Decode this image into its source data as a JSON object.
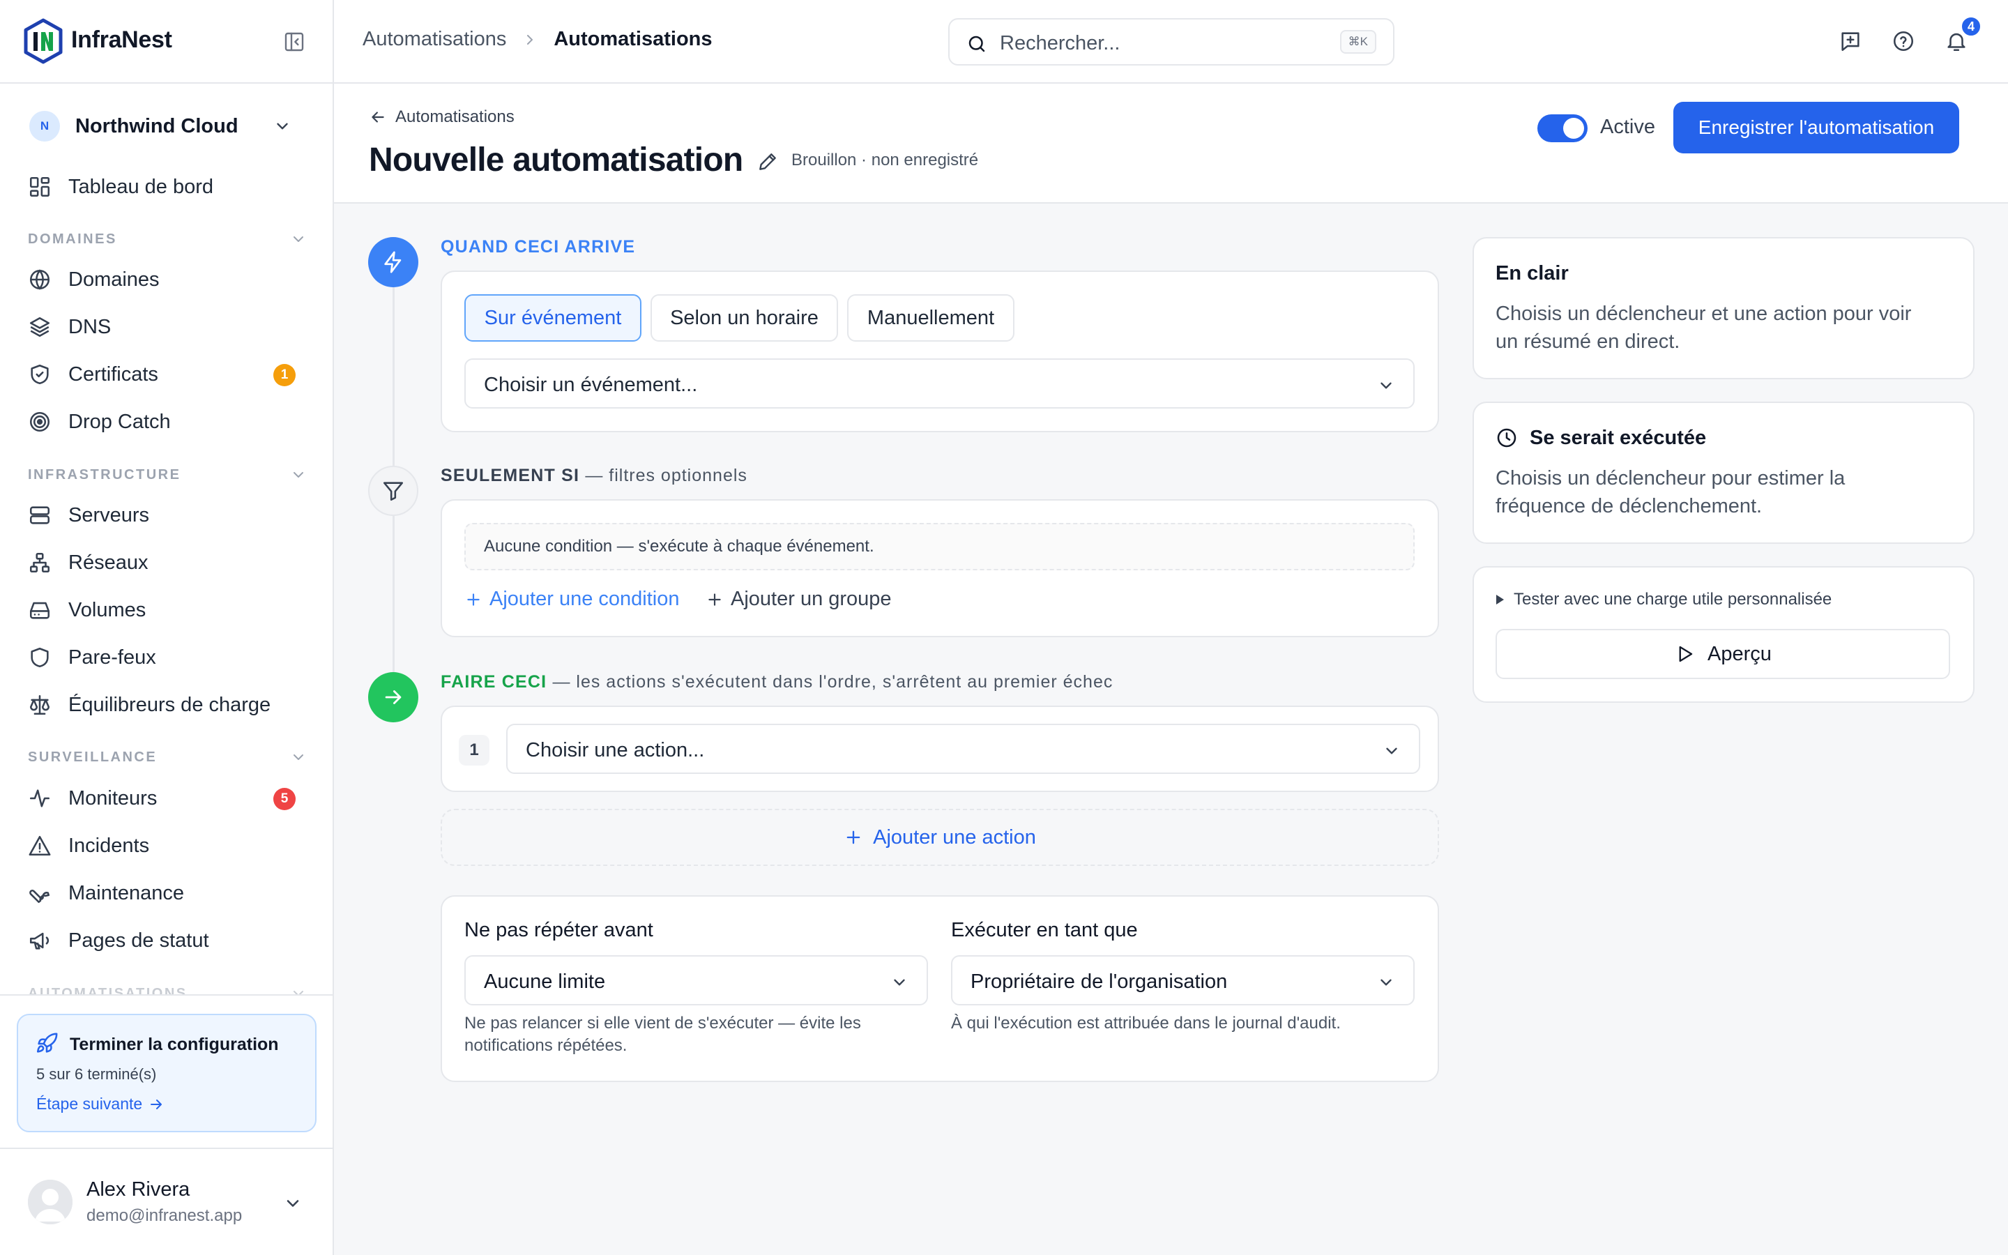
{
  "app": {
    "name": "InfraNest"
  },
  "org": {
    "name": "Northwind Cloud",
    "initial": "N"
  },
  "nav": {
    "dashboard": "Tableau de bord",
    "sections": {
      "domains": "DOMAINES",
      "infrastructure": "INFRASTRUCTURE",
      "monitoring": "SURVEILLANCE",
      "automations": "AUTOMATISATIONS"
    },
    "items": [
      {
        "label": "Domaines",
        "icon": "globe-icon"
      },
      {
        "label": "DNS",
        "icon": "layers-icon"
      },
      {
        "label": "Certificats",
        "icon": "shield-check-icon",
        "badge": "1"
      },
      {
        "label": "Drop Catch",
        "icon": "target-icon"
      },
      {
        "label": "Serveurs",
        "icon": "server-icon"
      },
      {
        "label": "Réseaux",
        "icon": "network-icon"
      },
      {
        "label": "Volumes",
        "icon": "hard-drive-icon"
      },
      {
        "label": "Pare-feux",
        "icon": "shield-icon"
      },
      {
        "label": "Équilibreurs de charge",
        "icon": "scale-icon"
      },
      {
        "label": "Moniteurs",
        "icon": "activity-icon",
        "badge": "5"
      },
      {
        "label": "Incidents",
        "icon": "alert-triangle-icon"
      },
      {
        "label": "Maintenance",
        "icon": "wrench-icon"
      },
      {
        "label": "Pages de statut",
        "icon": "megaphone-icon"
      }
    ],
    "badge_colors": {
      "warning": "#f59e0b",
      "danger": "#ef4444"
    }
  },
  "setup": {
    "title": "Terminer la configuration",
    "progress": "5 sur 6 terminé(s)",
    "next": "Étape suivante"
  },
  "user": {
    "name": "Alex Rivera",
    "email": "demo@infranest.app"
  },
  "header": {
    "breadcrumb": [
      "Automatisations",
      "Automatisations"
    ],
    "search_placeholder": "Rechercher...",
    "search_shortcut": "⌘K",
    "notifications_count": "4"
  },
  "page": {
    "back": "Automatisations",
    "title": "Nouvelle automatisation",
    "status": "Brouillon · non enregistré",
    "active_label": "Active",
    "active": true,
    "save": "Enregistrer l'automatisation"
  },
  "trigger": {
    "label": "QUAND CECI ARRIVE",
    "tabs": [
      "Sur événement",
      "Selon un horaire",
      "Manuellement"
    ],
    "selected_tab": "Sur événement",
    "event_select": "Choisir un événement..."
  },
  "filters": {
    "label": "SEULEMENT SI",
    "label_suffix": "— filtres optionnels",
    "empty": "Aucune condition — s'exécute à chaque événement.",
    "add_condition": "Ajouter une condition",
    "add_group": "Ajouter un groupe"
  },
  "actions": {
    "label": "FAIRE CECI",
    "label_suffix": "— les actions s'exécutent dans l'ordre, s'arrêtent au premier échec",
    "items": [
      {
        "num": "1",
        "placeholder": "Choisir une action..."
      }
    ],
    "add_action": "Ajouter une action"
  },
  "options": {
    "throttle_label": "Ne pas répéter avant",
    "throttle_value": "Aucune limite",
    "throttle_help_1": "Ne pas relancer si elle vient de s'exécuter — évite les",
    "throttle_help_2": "notifications répétées.",
    "run_as_label": "Exécuter en tant que",
    "run_as_value": "Propriétaire de l'organisation",
    "run_as_help": "À qui l'exécution est attribuée dans le journal d'audit."
  },
  "summary": {
    "title": "En clair",
    "text_1": "Choisis un déclencheur et une action pour voir",
    "text_2": "un résumé en direct."
  },
  "frequency": {
    "title": "Se serait exécutée",
    "text_1": "Choisis un déclencheur pour estimer la",
    "text_2": "fréquence de déclenchement."
  },
  "tester": {
    "toggle": "Tester avec une charge utile personnalisée",
    "preview": "Aperçu"
  },
  "colors": {
    "accent": "#2563eb",
    "success": "#22c55e",
    "trigger_label": "#3b82f6",
    "action_label": "#16a34a"
  }
}
